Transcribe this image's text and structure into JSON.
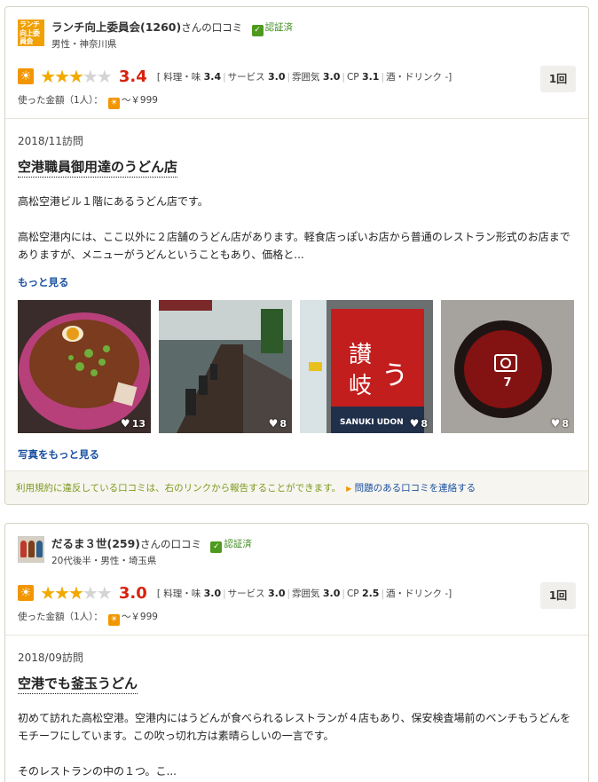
{
  "reviews": [
    {
      "avatar_text": "ランチ向上委員会",
      "reviewer_name": "ランチ向上委員会(1260)",
      "reviewer_suffix": "さんの口コミ",
      "verified_label": "認証済",
      "demographics": "男性・神奈川県",
      "rating": {
        "overall": "3.4",
        "stars_filled": 3,
        "stars_total": 5,
        "details_prefix": "[ 料理・味",
        "food": "3.4",
        "service_label": "サービス",
        "service": "3.0",
        "atmosphere_label": "雰囲気",
        "atmosphere": "3.0",
        "cp_label": "CP",
        "cp": "3.1",
        "drink_label": "酒・ドリンク -]"
      },
      "visits": "1回",
      "price_label": "使った金額（1人）：",
      "price_value": "～￥999",
      "visit_date": "2018/11訪問",
      "title": "空港職員御用達のうどん店",
      "body": [
        "高松空港ビル１階にあるうどん店です。",
        "",
        "高松空港内には、ここ以外に２店舗のうどん店があります。軽食店っぽいお店から普通のレストラン形式のお店までありますが、メニューがうどんということもあり、価格と..."
      ],
      "more_label": "もっと見る",
      "photos": [
        {
          "alt": "牛肉うどん",
          "likes": "13"
        },
        {
          "alt": "店内",
          "likes": "8"
        },
        {
          "alt": "讃岐うどん 入口",
          "likes": "8"
        },
        {
          "alt": "はし家 ロゴ",
          "likes": "8",
          "more_count": "7"
        }
      ],
      "photos_more_label": "写真をもっと見る",
      "report_note": "利用規約に違反している口コミは、右のリンクから報告することができます。",
      "report_link": "問題のある口コミを連絡する"
    },
    {
      "reviewer_name": "だるま３世(259)",
      "reviewer_suffix": "さんの口コミ",
      "verified_label": "認証済",
      "demographics": "20代後半・男性・埼玉県",
      "rating": {
        "overall": "3.0",
        "stars_filled": 3,
        "stars_total": 5,
        "details_prefix": "[ 料理・味",
        "food": "3.0",
        "service_label": "サービス",
        "service": "3.0",
        "atmosphere_label": "雰囲気",
        "atmosphere": "3.0",
        "cp_label": "CP",
        "cp": "2.5",
        "drink_label": "酒・ドリンク -]"
      },
      "visits": "1回",
      "price_label": "使った金額（1人）：",
      "price_value": "～￥999",
      "visit_date": "2018/09訪問",
      "title": "空港でも釜玉うどん",
      "body": [
        "初めて訪れた高松空港。空港内にはうどんが食べられるレストランが４店もあり、保安検査場前のベンチもうどんをモチーフにしています。この吹っ切れ方は素晴らしいの一言です。",
        "",
        "そのレストランの中の１つ。こ..."
      ]
    }
  ],
  "colors": {
    "accent_orange": "#f29600",
    "score_red": "#d7220e",
    "link_blue": "#1a50a0",
    "verified_green": "#4d9a1e"
  }
}
